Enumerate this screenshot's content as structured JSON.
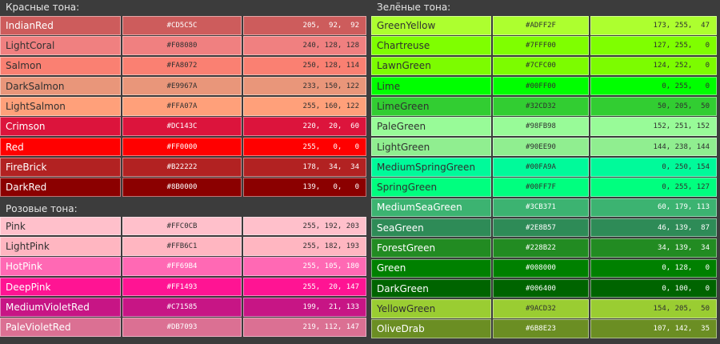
{
  "left": {
    "groups": [
      {
        "title": "Красные тона:",
        "rows": [
          {
            "name": "IndianRed",
            "hex": "#CD5C5C",
            "rgb": "205,  92,  92",
            "bg": "#CD5C5C",
            "fg": "#ffffff"
          },
          {
            "name": "LightCoral",
            "hex": "#F08080",
            "rgb": "240, 128, 128",
            "bg": "#F08080",
            "fg": "#303030"
          },
          {
            "name": "Salmon",
            "hex": "#FA8072",
            "rgb": "250, 128, 114",
            "bg": "#FA8072",
            "fg": "#303030"
          },
          {
            "name": "DarkSalmon",
            "hex": "#E9967A",
            "rgb": "233, 150, 122",
            "bg": "#E9967A",
            "fg": "#303030"
          },
          {
            "name": "LightSalmon",
            "hex": "#FFA07A",
            "rgb": "255, 160, 122",
            "bg": "#FFA07A",
            "fg": "#303030"
          },
          {
            "name": "Crimson",
            "hex": "#DC143C",
            "rgb": "220,  20,  60",
            "bg": "#DC143C",
            "fg": "#ffffff"
          },
          {
            "name": "Red",
            "hex": "#FF0000",
            "rgb": "255,   0,   0",
            "bg": "#FF0000",
            "fg": "#ffffff"
          },
          {
            "name": "FireBrick",
            "hex": "#B22222",
            "rgb": "178,  34,  34",
            "bg": "#B22222",
            "fg": "#ffffff"
          },
          {
            "name": "DarkRed",
            "hex": "#8B0000",
            "rgb": "139,   0,   0",
            "bg": "#8B0000",
            "fg": "#ffffff"
          }
        ]
      },
      {
        "title": "Розовые тона:",
        "rows": [
          {
            "name": "Pink",
            "hex": "#FFC0CB",
            "rgb": "255, 192, 203",
            "bg": "#FFC0CB",
            "fg": "#303030"
          },
          {
            "name": "LightPink",
            "hex": "#FFB6C1",
            "rgb": "255, 182, 193",
            "bg": "#FFB6C1",
            "fg": "#303030"
          },
          {
            "name": "HotPink",
            "hex": "#FF69B4",
            "rgb": "255, 105, 180",
            "bg": "#FF69B4",
            "fg": "#ffffff"
          },
          {
            "name": "DeepPink",
            "hex": "#FF1493",
            "rgb": "255,  20, 147",
            "bg": "#FF1493",
            "fg": "#ffffff"
          },
          {
            "name": "MediumVioletRed",
            "hex": "#C71585",
            "rgb": "199,  21, 133",
            "bg": "#C71585",
            "fg": "#ffffff"
          },
          {
            "name": "PaleVioletRed",
            "hex": "#DB7093",
            "rgb": "219, 112, 147",
            "bg": "#DB7093",
            "fg": "#ffffff"
          }
        ]
      }
    ]
  },
  "right": {
    "groups": [
      {
        "title": "Зелёные тона:",
        "rows": [
          {
            "name": "GreenYellow",
            "hex": "#ADFF2F",
            "rgb": "173, 255,  47",
            "bg": "#ADFF2F",
            "fg": "#303030"
          },
          {
            "name": "Chartreuse",
            "hex": "#7FFF00",
            "rgb": "127, 255,   0",
            "bg": "#7FFF00",
            "fg": "#303030"
          },
          {
            "name": "LawnGreen",
            "hex": "#7CFC00",
            "rgb": "124, 252,   0",
            "bg": "#7CFC00",
            "fg": "#303030"
          },
          {
            "name": "Lime",
            "hex": "#00FF00",
            "rgb": "  0, 255,   0",
            "bg": "#00FF00",
            "fg": "#303030"
          },
          {
            "name": "LimeGreen",
            "hex": "#32CD32",
            "rgb": " 50, 205,  50",
            "bg": "#32CD32",
            "fg": "#303030"
          },
          {
            "name": "PaleGreen",
            "hex": "#98FB98",
            "rgb": "152, 251, 152",
            "bg": "#98FB98",
            "fg": "#303030"
          },
          {
            "name": "LightGreen",
            "hex": "#90EE90",
            "rgb": "144, 238, 144",
            "bg": "#90EE90",
            "fg": "#303030"
          },
          {
            "name": "MediumSpringGreen",
            "hex": "#00FA9A",
            "rgb": "  0, 250, 154",
            "bg": "#00FA9A",
            "fg": "#303030"
          },
          {
            "name": "SpringGreen",
            "hex": "#00FF7F",
            "rgb": "  0, 255, 127",
            "bg": "#00FF7F",
            "fg": "#303030"
          },
          {
            "name": "MediumSeaGreen",
            "hex": "#3CB371",
            "rgb": " 60, 179, 113",
            "bg": "#3CB371",
            "fg": "#ffffff"
          },
          {
            "name": "SeaGreen",
            "hex": "#2E8B57",
            "rgb": " 46, 139,  87",
            "bg": "#2E8B57",
            "fg": "#ffffff"
          },
          {
            "name": "ForestGreen",
            "hex": "#228B22",
            "rgb": " 34, 139,  34",
            "bg": "#228B22",
            "fg": "#ffffff"
          },
          {
            "name": "Green",
            "hex": "#008000",
            "rgb": "  0, 128,   0",
            "bg": "#008000",
            "fg": "#ffffff"
          },
          {
            "name": "DarkGreen",
            "hex": "#006400",
            "rgb": "  0, 100,   0",
            "bg": "#006400",
            "fg": "#ffffff"
          },
          {
            "name": "YellowGreen",
            "hex": "#9ACD32",
            "rgb": "154, 205,  50",
            "bg": "#9ACD32",
            "fg": "#303030"
          },
          {
            "name": "OliveDrab",
            "hex": "#6B8E23",
            "rgb": "107, 142,  35",
            "bg": "#6B8E23",
            "fg": "#ffffff"
          }
        ]
      }
    ]
  }
}
